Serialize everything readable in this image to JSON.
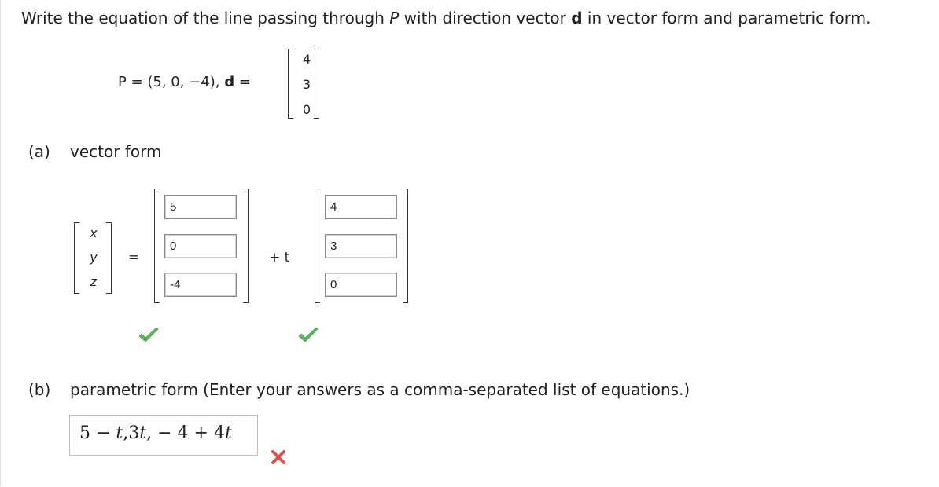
{
  "question": {
    "prefix": "Write the equation of the line passing through ",
    "point_var": "P",
    "middle": " with direction vector ",
    "dir_var": "d",
    "suffix": " in vector form and parametric form."
  },
  "given": {
    "point_text": "P = (5, 0, −4), ",
    "dir_label": "d",
    "equals": " =",
    "direction": [
      "4",
      "3",
      "0"
    ]
  },
  "part_a": {
    "label": "(a)",
    "title": "vector form",
    "variables": [
      "x",
      "y",
      "z"
    ],
    "equals": "=",
    "plus_t": "+ t",
    "point_inputs": [
      "5",
      "0",
      "-4"
    ],
    "direction_inputs": [
      "4",
      "3",
      "0"
    ],
    "point_status": "correct",
    "direction_status": "correct"
  },
  "part_b": {
    "label": "(b)",
    "instruction": "parametric form (Enter your answers as a comma-separated list of equations.)",
    "answer": {
      "pre": "5 − ",
      "t1": "t",
      "mid": ",3",
      "t2": "t",
      "post": ", − 4 + 4",
      "t3": "t"
    },
    "status": "incorrect"
  },
  "colors": {
    "check_green": "#5cb85c",
    "cross_red": "#d9534f"
  },
  "icons": {
    "correct": "checkmark-icon",
    "incorrect": "cross-icon"
  }
}
